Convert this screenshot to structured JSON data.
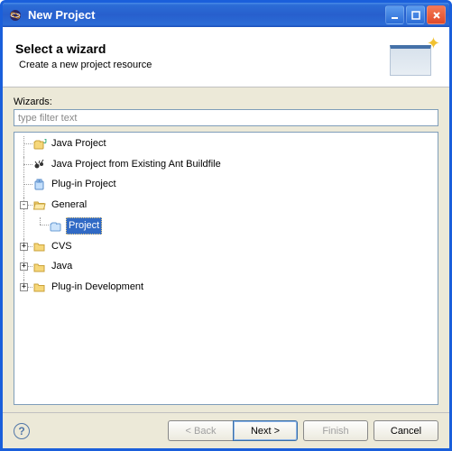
{
  "window": {
    "title": "New Project"
  },
  "header": {
    "title": "Select a wizard",
    "subtitle": "Create a new project resource"
  },
  "wizards": {
    "label": "Wizards:",
    "filter_placeholder": "type filter text"
  },
  "tree": {
    "java_project": "Java Project",
    "java_project_ant": "Java Project from Existing Ant Buildfile",
    "plugin_project": "Plug-in Project",
    "general": "General",
    "general_project": "Project",
    "cvs": "CVS",
    "java": "Java",
    "plugin_dev": "Plug-in Development"
  },
  "buttons": {
    "back": "< Back",
    "next": "Next >",
    "finish": "Finish",
    "cancel": "Cancel"
  }
}
